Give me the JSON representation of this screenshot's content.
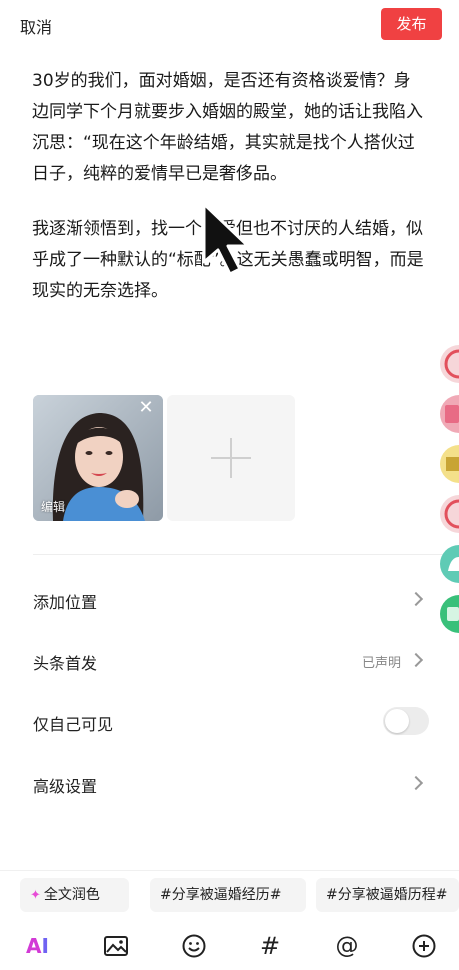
{
  "header": {
    "cancel_label": "取消",
    "publish_label": "发布",
    "publish_color": "#f04142"
  },
  "post": {
    "paragraphs": [
      "30岁的我们，面对婚姻，是否还有资格谈爱情？身边同学下个月就要步入婚姻的殿堂，她的话让我陷入沉思：“现在这个年龄结婚，其实就是找个人搭伙过日子，纯粹的爱情早已是奢侈品。",
      "我逐渐领悟到，找一个不爱但也不讨厌的人结婚，似乎成了一种默认的“标配”。这无关愚蠢或明智，而是现实的无奈选择。"
    ]
  },
  "images": {
    "photo_edit_label": "编辑",
    "close_icon": "close-icon",
    "add_icon": "plus-icon"
  },
  "settings": {
    "items": [
      {
        "label": "添加位置",
        "value": "",
        "control": "chevron"
      },
      {
        "label": "头条首发",
        "value": "已声明",
        "control": "chevron"
      },
      {
        "label": "仅自己可见",
        "value": "",
        "control": "toggle",
        "toggle_on": false
      },
      {
        "label": "高级设置",
        "value": "",
        "control": "chevron"
      }
    ]
  },
  "tags_bar": {
    "polish_label": "全文润色",
    "tags": [
      "#分享被逼婚经历#",
      "#分享被逼婚历程#"
    ]
  },
  "toolbar": {
    "ai_label_a": "A",
    "ai_label_i": "I",
    "hashtag_label": "#",
    "mention_label": "@",
    "icons": [
      "ai-icon",
      "image-icon",
      "emoji-icon",
      "hashtag-icon",
      "mention-icon",
      "add-circle-icon"
    ]
  }
}
